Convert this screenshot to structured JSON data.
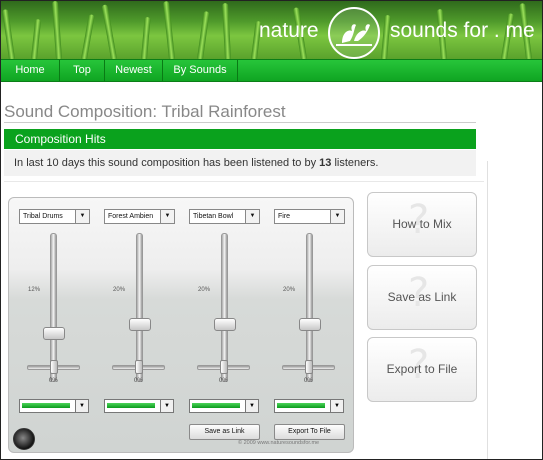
{
  "header": {
    "title_left": "nature",
    "title_right": "sounds for . me",
    "logo_icon": "birds-logo-icon"
  },
  "nav": {
    "items": [
      {
        "label": "Home"
      },
      {
        "label": "Top"
      },
      {
        "label": "Newest"
      },
      {
        "label": "By Sounds"
      }
    ]
  },
  "page": {
    "title": "Sound Composition: Tribal Rainforest"
  },
  "hits": {
    "heading": "Composition Hits",
    "text_before": "In last 10 days this sound composition has been listened to by ",
    "count": "13",
    "text_after": " listeners."
  },
  "mixer": {
    "channels": [
      {
        "sound": "Tribal Drums",
        "volume": "12",
        "pan": "0"
      },
      {
        "sound": "Forest Ambien",
        "volume": "20",
        "pan": "0"
      },
      {
        "sound": "Tibetan Bowl",
        "volume": "20",
        "pan": "0"
      },
      {
        "sound": "Fire",
        "volume": "20",
        "pan": "0"
      }
    ],
    "percent_sign": "%",
    "save_link_label": "Save as Link",
    "export_label": "Export To File",
    "copyright": "© 2009 www.naturesoundsfor.me",
    "colors": {
      "green": "#0ca21d"
    }
  },
  "side_buttons": [
    {
      "label": "How to Mix"
    },
    {
      "label": "Save as Link"
    },
    {
      "label": "Export to File"
    }
  ]
}
